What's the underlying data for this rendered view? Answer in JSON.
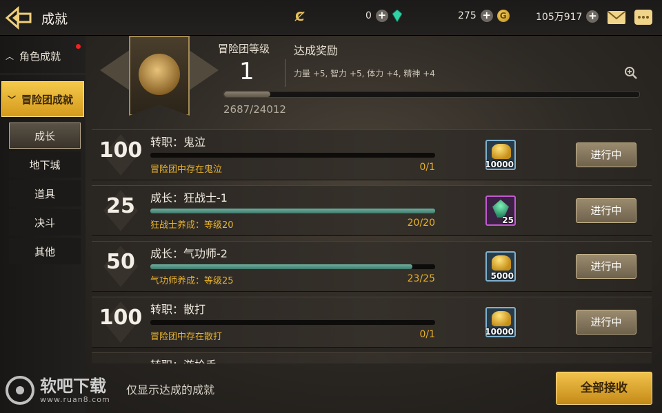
{
  "topbar": {
    "title": "成就",
    "resources": [
      {
        "name": "gem",
        "value": "0"
      },
      {
        "name": "coin",
        "value": "275"
      },
      {
        "name": "gold",
        "value": "105万917"
      }
    ],
    "colors": {
      "accent_gold": "#f2c24a",
      "progress_teal": "#4f9484",
      "text_amber": "#e7b22c"
    }
  },
  "sidebar": {
    "categories": [
      {
        "label": "角色成就",
        "expanded": false,
        "has_notification": true
      },
      {
        "label": "冒险团成就",
        "expanded": true,
        "active": true
      }
    ],
    "subitems": [
      "成长",
      "地下城",
      "道具",
      "决斗",
      "其他"
    ],
    "active_subitem": "成长"
  },
  "header": {
    "level_label": "冒险团等级",
    "level": "1",
    "reward_label": "达成奖励",
    "reward_text": "力量 +5, 智力 +5, 体力 +4, 精神 +4",
    "exp_text": "2687/24012",
    "exp_current": 2687,
    "exp_total": 24012
  },
  "tasks": [
    {
      "points": "100",
      "title": "转职：鬼泣",
      "condition": "冒险团中存在鬼泣",
      "count": "0/1",
      "progress": 0.0,
      "reward_icon": "gold-coins-icon",
      "reward_qty": "10000",
      "status": "进行中"
    },
    {
      "points": "25",
      "title": "成长：狂战士-1",
      "condition": "狂战士养成：等级20",
      "count": "20/20",
      "progress": 1.0,
      "reward_icon": "green-crystal-icon",
      "reward_qty": "25",
      "status": "进行中"
    },
    {
      "points": "50",
      "title": "成长：气功师-2",
      "condition": "气功师养成：等级25",
      "count": "23/25",
      "progress": 0.92,
      "reward_icon": "gold-coins-icon",
      "reward_qty": "5000",
      "status": "进行中"
    },
    {
      "points": "100",
      "title": "转职：散打",
      "condition": "冒险团中存在散打",
      "count": "0/1",
      "progress": 0.0,
      "reward_icon": "gold-coins-icon",
      "reward_qty": "10000",
      "status": "进行中"
    },
    {
      "points": "",
      "title": "转职：游枪手",
      "condition": "",
      "count": "",
      "progress": 0.0,
      "reward_icon": "",
      "reward_qty": "",
      "status": ""
    }
  ],
  "footer": {
    "watermark_name": "软吧下载",
    "watermark_url": "www.ruan8.com",
    "filter_label": "仅显示达成的成就",
    "claim_all_label": "全部接收"
  }
}
